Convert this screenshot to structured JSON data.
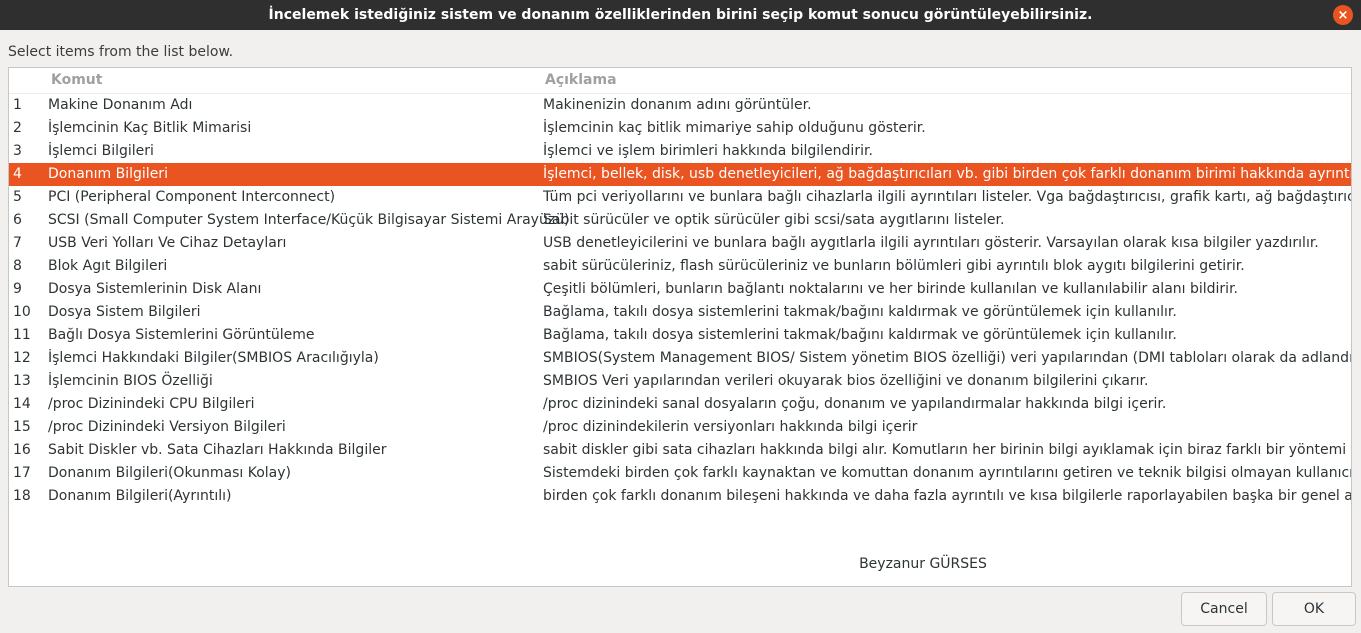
{
  "window": {
    "title": "İncelemek istediğiniz sistem ve donanım özelliklerinden birini seçip komut sonucu görüntüleyebilirsiniz.",
    "close_icon": "×"
  },
  "instruction": "Select items from the list below.",
  "list": {
    "columns": {
      "komut": "Komut",
      "aciklama": "Açıklama"
    },
    "selected_index": 3,
    "rows": [
      {
        "n": "1",
        "cmd": "Makine Donanım Adı",
        "desc": "Makinenizin donanım adını görüntüler."
      },
      {
        "n": "2",
        "cmd": "İşlemcinin Kaç Bitlik Mimarisi",
        "desc": "İşlemcinin kaç bitlik mimariye sahip olduğunu gösterir."
      },
      {
        "n": "3",
        "cmd": "İşlemci Bilgileri",
        "desc": "İşlemci ve işlem birimleri  hakkında bilgilendirir."
      },
      {
        "n": "4",
        "cmd": "Donanım Bilgileri",
        "desc": "İşlemci, bellek, disk, usb denetleyicileri, ağ bağdaştırıcıları vb. gibi birden çok farklı donanım birimi hakkında ayrıntılı ve kısa"
      },
      {
        "n": "5",
        "cmd": "PCI (Peripheral Component Interconnect)",
        "desc": "Tüm pci veriyollarını ve bunlara bağlı cihazlarla ilgili ayrıntıları listeler. Vga bağdaştırıcısı, grafik kartı, ağ bağdaştırıcısı, usb"
      },
      {
        "n": "6",
        "cmd": "SCSI (Small Computer System Interface/Küçük Bilgisayar Sistemi Arayüzü)",
        "desc": "Sabit sürücüler ve optik sürücüler gibi scsi/sata aygıtlarını listeler."
      },
      {
        "n": "7",
        "cmd": "USB Veri Yolları Ve Cihaz Detayları",
        "desc": " USB denetleyicilerini ve bunlara bağlı aygıtlarla ilgili ayrıntıları gösterir. Varsayılan olarak kısa bilgiler yazdırılır."
      },
      {
        "n": "8",
        "cmd": "Blok Agıt Bilgileri",
        "desc": "sabit sürücüleriniz, flash sürücüleriniz ve bunların bölümleri gibi ayrıntılı blok aygıtı bilgilerini getirir."
      },
      {
        "n": "9",
        "cmd": "Dosya Sistemlerinin Disk Alanı",
        "desc": "Çeşitli bölümleri, bunların bağlantı noktalarını ve her birinde kullanılan ve kullanılabilir alanı bildirir."
      },
      {
        "n": "10",
        "cmd": "Dosya Sistem Bilgileri",
        "desc": "Bağlama, takılı dosya sistemlerini takmak/bağını kaldırmak ve görüntülemek için kullanılır."
      },
      {
        "n": "11",
        "cmd": "Bağlı Dosya Sistemlerini Görüntüleme",
        "desc": "Bağlama, takılı dosya sistemlerini takmak/bağını kaldırmak ve görüntülemek için kullanılır."
      },
      {
        "n": "12",
        "cmd": "İşlemci Hakkındaki Bilgiler(SMBIOS Aracılığıyla)",
        "desc": "SMBIOS(System Management BIOS/ Sistem yönetim BIOS özelliği)  veri yapılarından (DMI tabloları olarak da adlandırılır) ve"
      },
      {
        "n": "13",
        "cmd": "İşlemcinin BIOS Özelliği",
        "desc": "SMBIOS Veri yapılarından  verileri okuyarak bios özelliğini ve  donanım bilgilerini çıkarır."
      },
      {
        "n": "14",
        "cmd": "/proc Dizinindeki CPU Bilgileri",
        "desc": "/proc dizinindeki sanal dosyaların çoğu, donanım ve yapılandırmalar hakkında bilgi içerir."
      },
      {
        "n": "15",
        "cmd": "/proc Dizinindeki Versiyon Bilgileri",
        "desc": "/proc dizinindekilerin versiyonları  hakkında bilgi içerir"
      },
      {
        "n": "16",
        "cmd": "Sabit Diskler vb. Sata Cihazları Hakkında Bilgiler",
        "desc": "sabit diskler gibi sata cihazları hakkında bilgi alır. Komutların her birinin bilgi ayıklamak için biraz farklı bir yöntemi vardırE"
      },
      {
        "n": "17",
        "cmd": "Donanım Bilgileri(Okunması Kolay)",
        "desc": "Sistemdeki birden çok farklı kaynaktan ve komuttan donanım ayrıntılarını getiren ve teknik bilgisi olmayan kullanıcıların ko"
      },
      {
        "n": "18",
        "cmd": "Donanım Bilgileri(Ayrıntılı)",
        "desc": " birden çok farklı donanım bileşeni hakkında ve daha fazla ayrıntılı ve kısa bilgilerle raporlayabilen başka bir genel amaçlı d"
      }
    ],
    "footer_name": "Beyzanur GÜRSES"
  },
  "buttons": {
    "cancel": "Cancel",
    "ok": "OK"
  }
}
